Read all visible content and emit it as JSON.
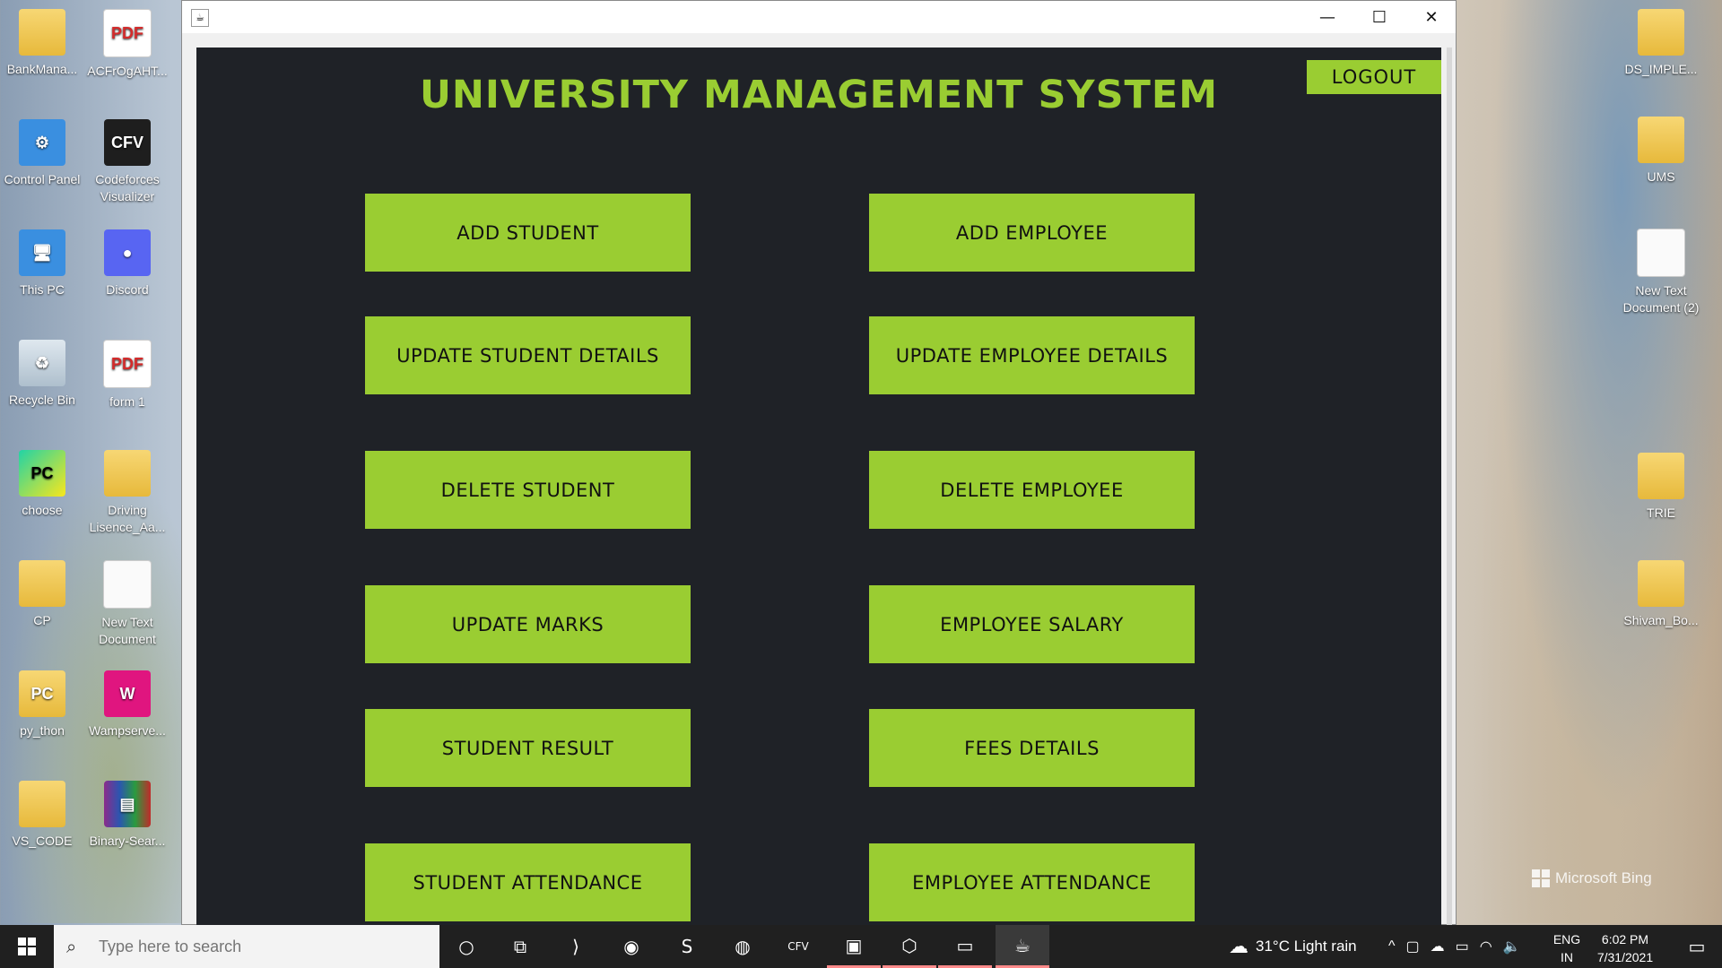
{
  "desktop": {
    "left_icons": [
      {
        "label": "BankMana...",
        "glyph": "",
        "kind": "folder"
      },
      {
        "label": "ACFrOgAHT...",
        "glyph": "PDF",
        "kind": "pdf"
      },
      {
        "label": "Control Panel",
        "glyph": "⚙",
        "kind": "blue"
      },
      {
        "label": "Codeforces Visualizer",
        "glyph": "CFV",
        "kind": "dark"
      },
      {
        "label": "This PC",
        "glyph": "🖥",
        "kind": "blue"
      },
      {
        "label": "Discord",
        "glyph": "●",
        "kind": "disc"
      },
      {
        "label": "Recycle Bin",
        "glyph": "♻",
        "kind": "bin"
      },
      {
        "label": "form 1",
        "glyph": "PDF",
        "kind": "pdf"
      },
      {
        "label": "choose",
        "glyph": "PC",
        "kind": "pc"
      },
      {
        "label": "Driving Lisence_Aa...",
        "glyph": "",
        "kind": "folder"
      },
      {
        "label": "CP",
        "glyph": "",
        "kind": "folder"
      },
      {
        "label": "New Text Document",
        "glyph": "",
        "kind": "doc"
      },
      {
        "label": "py_thon",
        "glyph": "PC",
        "kind": "folder"
      },
      {
        "label": "Wampserve...",
        "glyph": "W",
        "kind": "wamp"
      },
      {
        "label": "VS_CODE",
        "glyph": "",
        "kind": "folder"
      },
      {
        "label": "Binary-Sear...",
        "glyph": "▤",
        "kind": "rar"
      }
    ],
    "right_icons": [
      {
        "label": "DS_IMPLE...",
        "kind": "folder"
      },
      {
        "label": "UMS",
        "kind": "folder"
      },
      {
        "label": "New Text Document (2)",
        "kind": "doc"
      },
      {
        "label": "TRIE",
        "kind": "folder"
      },
      {
        "label": "Shivam_Bo...",
        "kind": "folder"
      }
    ],
    "bing_watermark": "Microsoft Bing"
  },
  "window": {
    "controls": {
      "minimize": "—",
      "maximize": "☐",
      "close": "✕"
    },
    "title": "UNIVERSITY MANAGEMENT SYSTEM",
    "logout": "LOGOUT",
    "left_buttons": [
      "ADD STUDENT",
      "UPDATE STUDENT DETAILS",
      "DELETE STUDENT",
      "UPDATE MARKS",
      "STUDENT RESULT",
      "STUDENT ATTENDANCE"
    ],
    "right_buttons": [
      "ADD EMPLOYEE",
      "UPDATE EMPLOYEE DETAILS",
      "DELETE EMPLOYEE",
      "EMPLOYEE SALARY",
      "FEES DETAILS",
      "EMPLOYEE ATTENDANCE"
    ],
    "accent": "#9acd32",
    "panel_bg": "#1f2227"
  },
  "taskbar": {
    "search_placeholder": "Type here to search",
    "apps": [
      {
        "name": "cortana-icon",
        "glyph": "○"
      },
      {
        "name": "task-view-icon",
        "glyph": "⧉"
      },
      {
        "name": "vscode-icon",
        "glyph": "⟩"
      },
      {
        "name": "chrome-icon",
        "glyph": "◉"
      },
      {
        "name": "sublime-icon",
        "glyph": "S"
      },
      {
        "name": "firefox-icon",
        "glyph": "◍"
      },
      {
        "name": "cfv-icon",
        "glyph": "CFV"
      },
      {
        "name": "app-icon",
        "glyph": "▣"
      },
      {
        "name": "virtualbox-icon",
        "glyph": "⬡"
      },
      {
        "name": "file-explorer-icon",
        "glyph": "▭"
      },
      {
        "name": "java-icon",
        "glyph": "☕"
      }
    ],
    "weather": "31°C  Light rain",
    "lang_top": "ENG",
    "lang_bottom": "IN",
    "time": "6:02 PM",
    "date": "7/31/2021"
  }
}
